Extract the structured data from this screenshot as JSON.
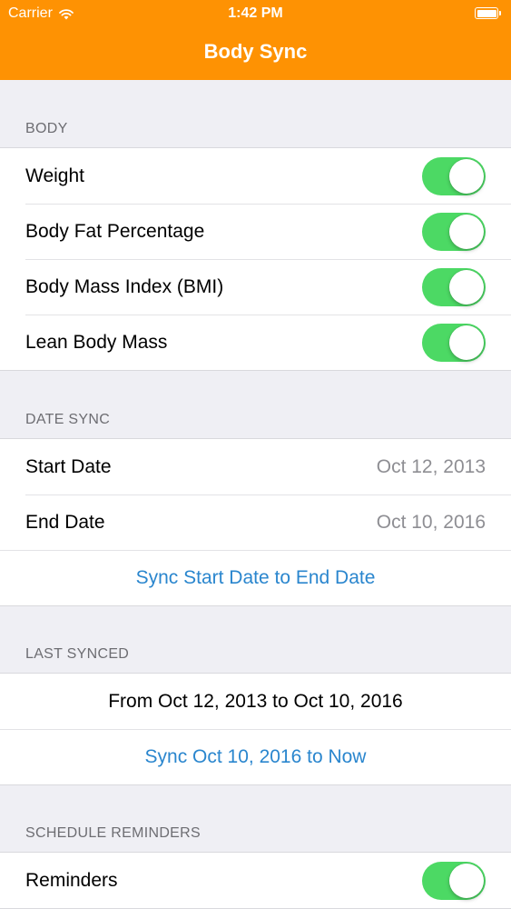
{
  "status_bar": {
    "carrier": "Carrier",
    "time": "1:42 PM"
  },
  "nav": {
    "title": "Body Sync",
    "bar_color": "#fe9203"
  },
  "sections": {
    "body": {
      "header": "BODY",
      "items": [
        {
          "label": "Weight",
          "on": true
        },
        {
          "label": "Body Fat Percentage",
          "on": true
        },
        {
          "label": "Body Mass Index (BMI)",
          "on": true
        },
        {
          "label": "Lean Body Mass",
          "on": true
        }
      ]
    },
    "date_sync": {
      "header": "DATE SYNC",
      "start_label": "Start Date",
      "start_value": "Oct 12, 2013",
      "end_label": "End Date",
      "end_value": "Oct 10, 2016",
      "action": "Sync Start Date to End Date"
    },
    "last_synced": {
      "header": "LAST SYNCED",
      "range": "From Oct 12, 2013 to Oct 10, 2016",
      "action": "Sync Oct 10, 2016 to Now"
    },
    "reminders": {
      "header": "SCHEDULE REMINDERS",
      "label": "Reminders",
      "on": true
    }
  },
  "colors": {
    "toggle_on": "#4cd964",
    "action_text": "#2a86ce"
  }
}
